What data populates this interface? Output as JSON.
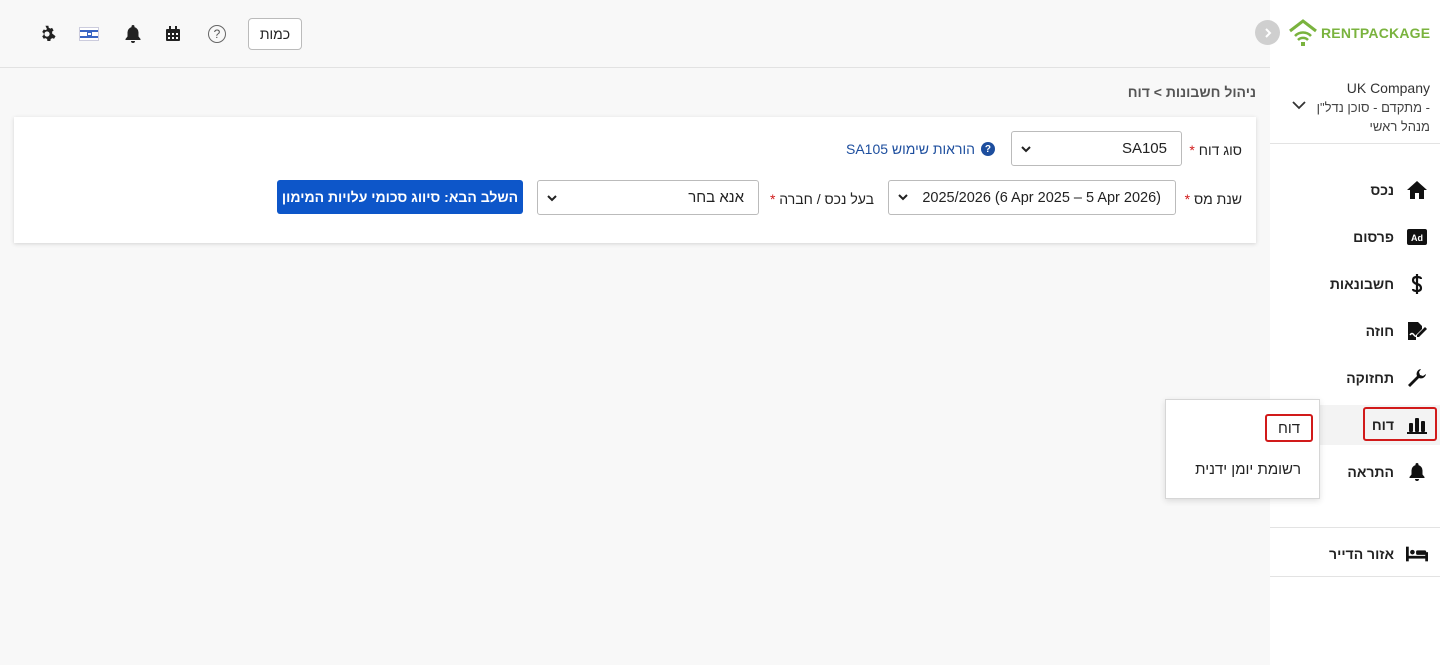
{
  "topbar": {
    "quantity_label": "כמות",
    "help_glyph": "?"
  },
  "sidebar": {
    "logo": {
      "part1": "RENT",
      "part2": "PACKAGE"
    },
    "company_name": "UK Company",
    "company_role_line1": "מתקדם - סוכן נדל\"ן -",
    "company_role_line2": "מנהל ראשי",
    "items": [
      {
        "label": "נכס",
        "icon": "home-icon"
      },
      {
        "label": "פרסום",
        "icon": "ad-icon"
      },
      {
        "label": "חשבונאות",
        "icon": "dollar-icon"
      },
      {
        "label": "חוזה",
        "icon": "contract-icon"
      },
      {
        "label": "תחזוקה",
        "icon": "wrench-icon"
      },
      {
        "label": "דוח",
        "icon": "chart-icon"
      },
      {
        "label": "התראה",
        "icon": "bell-icon"
      },
      {
        "label": "אזור הדייר",
        "icon": "bed-icon"
      }
    ]
  },
  "breadcrumb": "ניהול חשבונות > דוח",
  "form": {
    "report_type_label": "סוג דוח",
    "report_type_value": "SA105",
    "help_link": "הוראות שימוש SA105",
    "tax_year_label": "שנת מס",
    "tax_year_value": "2025/2026 (6 Apr 2025 – 5 Apr 2026)",
    "owner_label": "בעל נכס / חברה",
    "owner_value": "אנא בחר",
    "required_mark": "*",
    "next_button": "השלב הבא: סיווג סכומי עלויות המימון"
  },
  "menu": {
    "items": [
      "דוח",
      "רשומת יומן ידנית"
    ]
  },
  "colors": {
    "primary": "#0d56c9",
    "highlight": "#d11a1a",
    "logo_green": "#7ab33e"
  }
}
